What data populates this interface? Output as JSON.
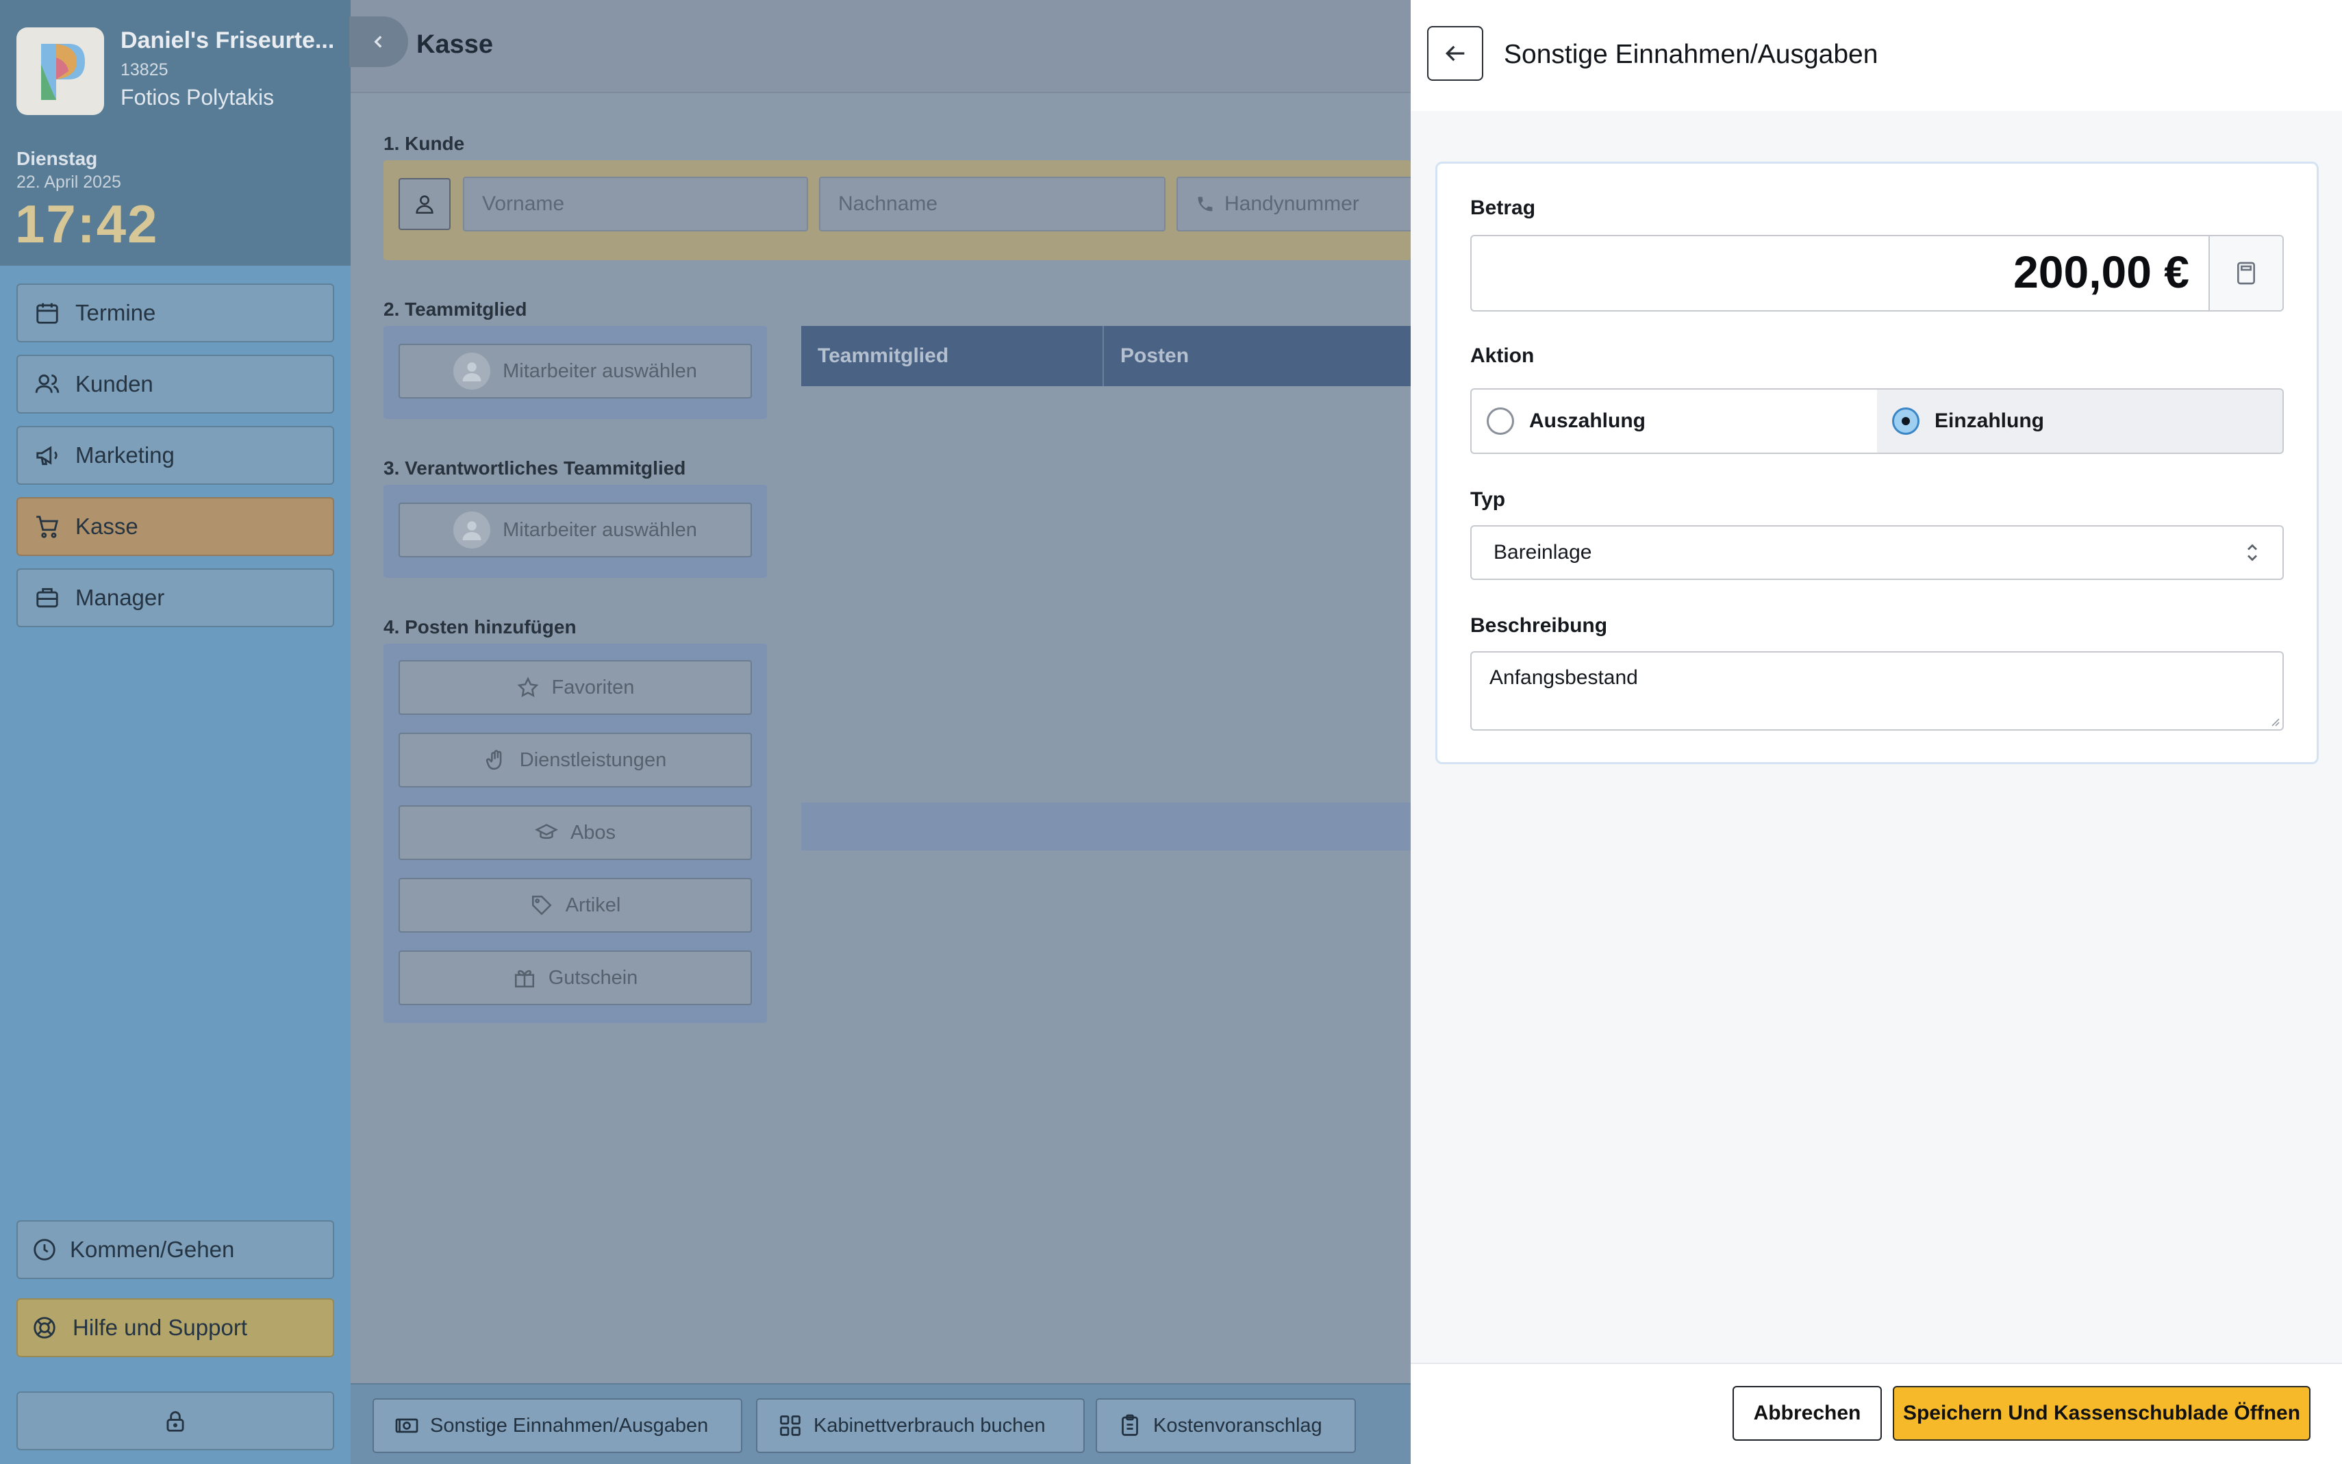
{
  "sidebar": {
    "shop_name": "Daniel's Friseurte...",
    "shop_id": "13825",
    "owner": "Fotios Polytakis",
    "weekday": "Dienstag",
    "date": "22. April 2025",
    "time": "17:42",
    "nav": [
      {
        "label": "Termine",
        "icon": "calendar-icon"
      },
      {
        "label": "Kunden",
        "icon": "users-icon"
      },
      {
        "label": "Marketing",
        "icon": "megaphone-icon"
      },
      {
        "label": "Kasse",
        "icon": "cart-icon",
        "active": true
      },
      {
        "label": "Manager",
        "icon": "briefcase-icon"
      }
    ],
    "kommen_gehen": "Kommen/Gehen",
    "help": "Hilfe und Support"
  },
  "main": {
    "title": "Kasse",
    "section1": "1. Kunde",
    "firstname_placeholder": "Vorname",
    "lastname_placeholder": "Nachname",
    "phone_placeholder": "Handynummer",
    "section2": "2. Teammitglied",
    "select_employee": "Mitarbeiter auswählen",
    "section3": "3. Verantwortliches Teammitglied",
    "section4": "4. Posten hinzufügen",
    "item_buttons": [
      "Favoriten",
      "Dienstleistungen",
      "Abos",
      "Artikel",
      "Gutschein"
    ],
    "table_headers": [
      "Teammitglied",
      "Posten"
    ],
    "bottom_buttons": [
      "Sonstige Einnahmen/Ausgaben",
      "Kabinettverbrauch buchen",
      "Kostenvoranschlag"
    ]
  },
  "modal": {
    "title": "Sonstige Einnahmen/Ausgaben",
    "amount_label": "Betrag",
    "amount_value": "200,00 €",
    "action_label": "Aktion",
    "action_options": [
      "Auszahlung",
      "Einzahlung"
    ],
    "action_selected": "Einzahlung",
    "type_label": "Typ",
    "type_value": "Bareinlage",
    "description_label": "Beschreibung",
    "description_value": "Anfangsbestand",
    "cancel_label": "Abbrechen",
    "save_label": "Speichern Und Kassenschublade Öffnen"
  },
  "colors": {
    "accent_yellow": "#f5b92a",
    "radio_selected": "#9fd0f2",
    "table_header": "#4a6384"
  }
}
